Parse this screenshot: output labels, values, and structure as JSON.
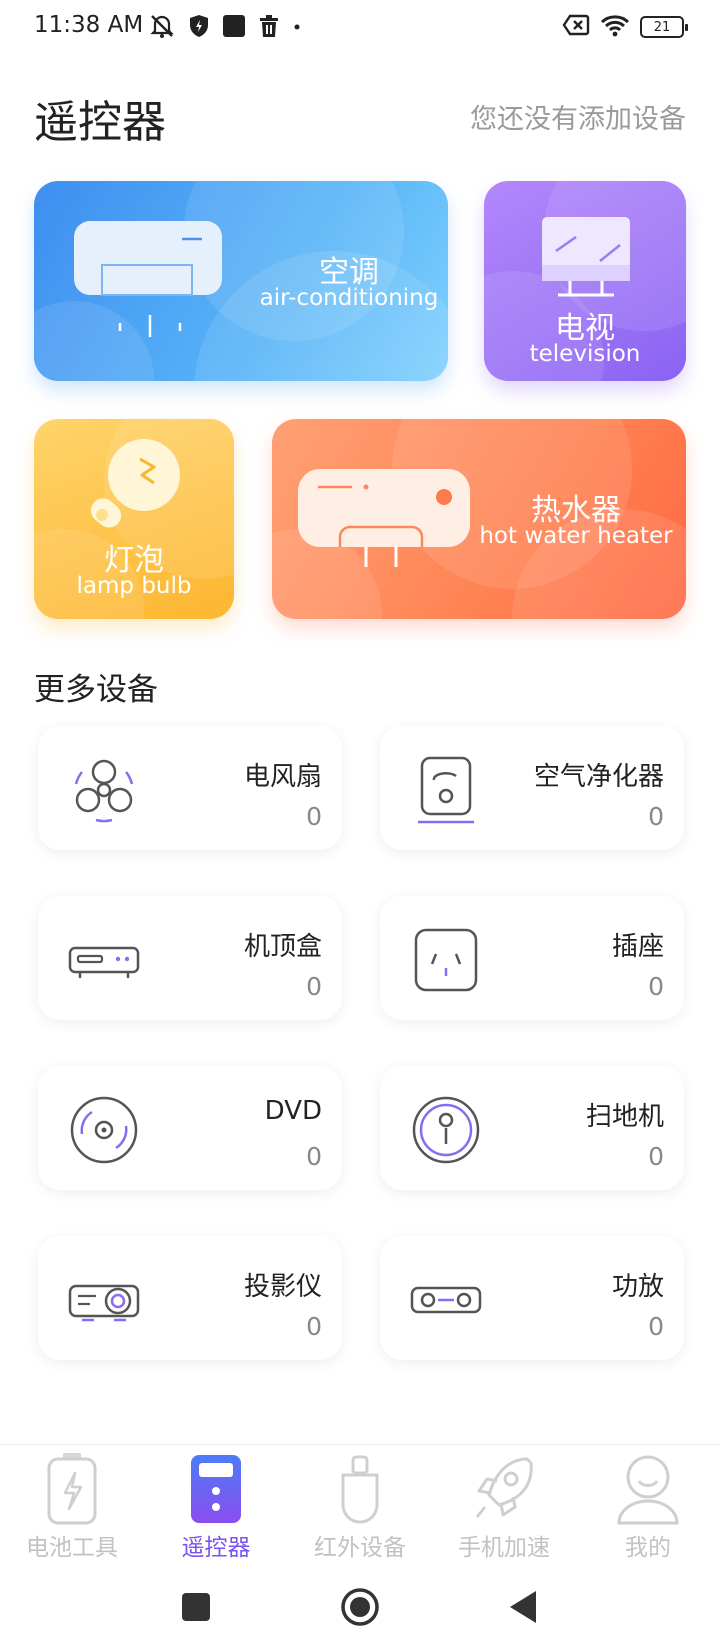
{
  "status_bar": {
    "time": "11:38 AM",
    "battery": "21"
  },
  "header": {
    "title": "遥控器",
    "hint": "您还没有添加设备"
  },
  "featured": {
    "ac": {
      "cn": "空调",
      "en": "air-conditioning"
    },
    "tv": {
      "cn": "电视",
      "en": "television"
    },
    "lamp": {
      "cn": "灯泡",
      "en": "lamp bulb"
    },
    "heater": {
      "cn": "热水器",
      "en": "hot water heater"
    }
  },
  "more_section": {
    "title": "更多设备",
    "devices": [
      {
        "name": "电风扇",
        "count": "0",
        "icon": "fan-icon"
      },
      {
        "name": "空气净化器",
        "count": "0",
        "icon": "air-purifier-icon"
      },
      {
        "name": "机顶盒",
        "count": "0",
        "icon": "set-top-box-icon"
      },
      {
        "name": "插座",
        "count": "0",
        "icon": "socket-icon"
      },
      {
        "name": "DVD",
        "count": "0",
        "icon": "dvd-icon"
      },
      {
        "name": "扫地机",
        "count": "0",
        "icon": "robot-vacuum-icon"
      },
      {
        "name": "投影仪",
        "count": "0",
        "icon": "projector-icon"
      },
      {
        "name": "功放",
        "count": "0",
        "icon": "amplifier-icon"
      }
    ]
  },
  "bottom_nav": {
    "items": [
      {
        "label": "电池工具",
        "icon": "battery-icon"
      },
      {
        "label": "遥控器",
        "icon": "remote-icon"
      },
      {
        "label": "红外设备",
        "icon": "infrared-icon"
      },
      {
        "label": "手机加速",
        "icon": "rocket-icon"
      },
      {
        "label": "我的",
        "icon": "profile-icon"
      }
    ],
    "active_index": 1
  },
  "colors": {
    "accent": "#7b52ef",
    "ac_card": "#4f9ff4",
    "tv_card": "#9b72f7",
    "lamp_card": "#fdc44a",
    "heater_card": "#ff7b4d"
  }
}
